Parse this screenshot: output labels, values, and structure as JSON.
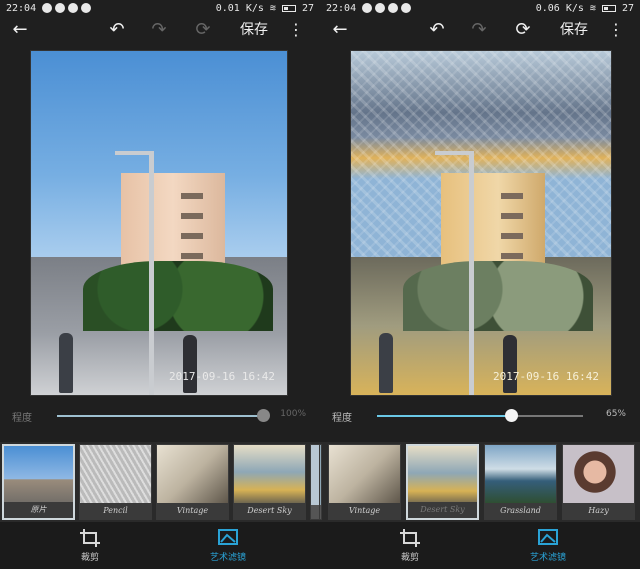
{
  "status_left": {
    "time": "22:04",
    "speed": "0.01 K/s",
    "battery": "27"
  },
  "status_right": {
    "time": "22:04",
    "speed": "0.06 K/s",
    "battery": "27"
  },
  "toolbar": {
    "save_label": "保存",
    "back_icon": "arrow-left-icon",
    "undo_icon": "undo-icon",
    "redo_icon": "redo-icon",
    "reset_icon": "reset-icon",
    "more_icon": "more-vertical-icon"
  },
  "photo": {
    "timestamp": "2017-09-16 16:42"
  },
  "left_slider": {
    "label": "程度",
    "value_text": "100%",
    "value": 1.0
  },
  "right_slider": {
    "label": "程度",
    "value_text": "65%",
    "value": 0.65
  },
  "left_filters": [
    {
      "label": "原片",
      "selected": true
    },
    {
      "label": "Pencil",
      "selected": false
    },
    {
      "label": "Vintage",
      "selected": false
    },
    {
      "label": "Desert Sky",
      "selected": false
    }
  ],
  "right_filters": [
    {
      "label": "Vintage",
      "selected": false
    },
    {
      "label": "Desert Sky",
      "selected": true
    },
    {
      "label": "Grassland",
      "selected": false
    },
    {
      "label": "Hazy",
      "selected": false
    }
  ],
  "bottom_nav": {
    "crop_label": "裁剪",
    "filters_label": "艺术滤镜",
    "accent_color": "#2aa3d6"
  }
}
